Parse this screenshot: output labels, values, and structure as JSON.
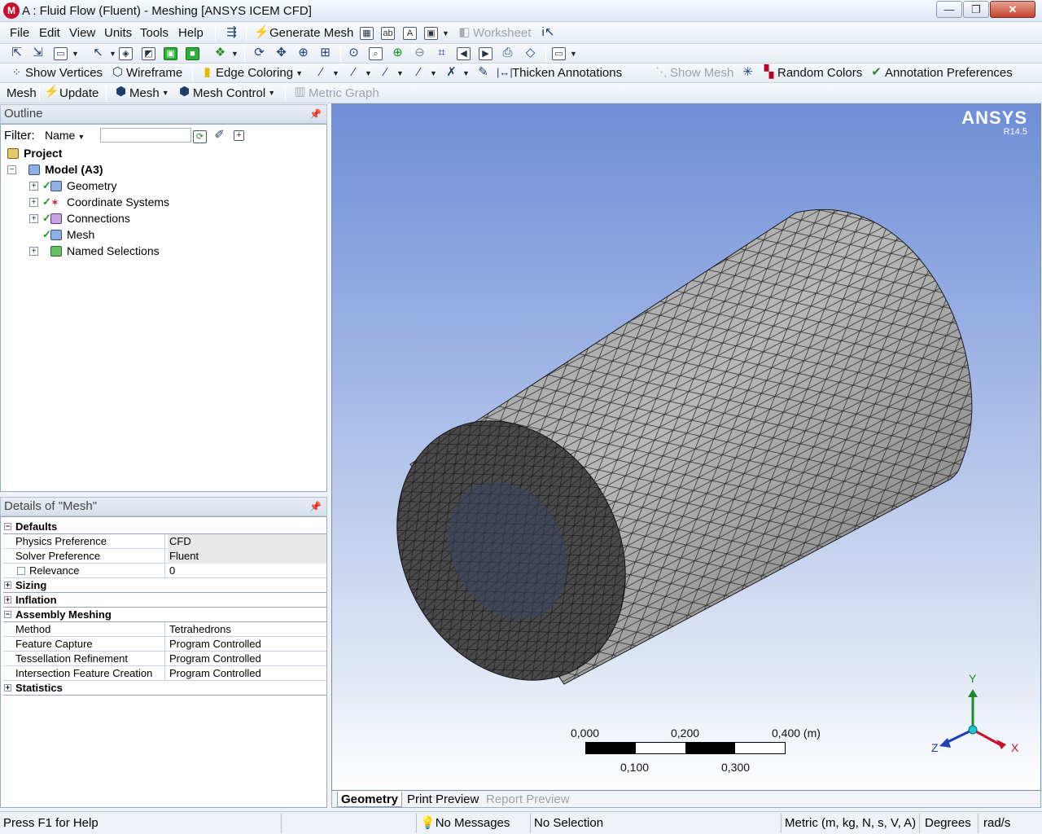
{
  "window": {
    "title": "A : Fluid Flow (Fluent) - Meshing [ANSYS ICEM CFD]",
    "logo_letter": "M",
    "minimize": "—",
    "maximize": "❐",
    "close": "✕"
  },
  "menu": [
    "File",
    "Edit",
    "View",
    "Units",
    "Tools",
    "Help"
  ],
  "toolbar1": {
    "generate_mesh": "Generate Mesh",
    "worksheet": "Worksheet"
  },
  "toolbar2": {
    "show_vertices": "Show Vertices",
    "wireframe": "Wireframe",
    "edge_coloring": "Edge Coloring",
    "thicken_annotations": "Thicken Annotations",
    "show_mesh": "Show Mesh",
    "random_colors": "Random Colors",
    "annotation_preferences": "Annotation Preferences"
  },
  "toolbar3": {
    "context": "Mesh",
    "update": "Update",
    "mesh": "Mesh",
    "mesh_control": "Mesh Control",
    "metric_graph": "Metric Graph"
  },
  "outline": {
    "title": "Outline",
    "pin": "ᵖ",
    "filter_label": "Filter:",
    "filter_option": "Name",
    "tree": [
      {
        "label": "Project"
      },
      {
        "label": "Model (A3)"
      },
      {
        "label": "Geometry"
      },
      {
        "label": "Coordinate Systems"
      },
      {
        "label": "Connections"
      },
      {
        "label": "Mesh"
      },
      {
        "label": "Named Selections"
      }
    ]
  },
  "details": {
    "title": "Details of \"Mesh\"",
    "rows": [
      {
        "name": "Defaults",
        "value": ""
      },
      {
        "name": "Physics Preference",
        "value": "CFD"
      },
      {
        "name": "Solver Preference",
        "value": "Fluent"
      },
      {
        "name": "Relevance",
        "value": "0"
      },
      {
        "name": "Sizing",
        "value": ""
      },
      {
        "name": "Inflation",
        "value": ""
      },
      {
        "name": "Assembly Meshing",
        "value": ""
      },
      {
        "name": "Method",
        "value": "Tetrahedrons"
      },
      {
        "name": "Feature Capture",
        "value": "Program Controlled"
      },
      {
        "name": "Tessellation Refinement",
        "value": "Program Controlled"
      },
      {
        "name": "Intersection Feature Creation",
        "value": "Program Controlled"
      },
      {
        "name": "Statistics",
        "value": ""
      }
    ]
  },
  "viewport": {
    "brand": "ANSYS",
    "version": "R14.5",
    "scale": {
      "labels_top": [
        "0,000",
        "0,200",
        "0,400 (m)"
      ],
      "labels_bottom": [
        "0,100",
        "0,300"
      ]
    },
    "axes": {
      "x": "X",
      "y": "Y",
      "z": "Z"
    },
    "colors": {
      "mesh_face": "#a9a9a9",
      "mesh_edge": "#1a1a1a",
      "axis_x": "#c8102e",
      "axis_y": "#1d8a2c",
      "axis_z": "#1d3fb8"
    }
  },
  "view_tabs": [
    "Geometry",
    "Print Preview",
    "Report Preview"
  ],
  "status": {
    "help": "Press F1 for Help",
    "messages": "No Messages",
    "selection": "No Selection",
    "units": "Metric (m, kg, N, s, V, A)",
    "angle": "Degrees",
    "angular_velocity": "rad/s"
  }
}
